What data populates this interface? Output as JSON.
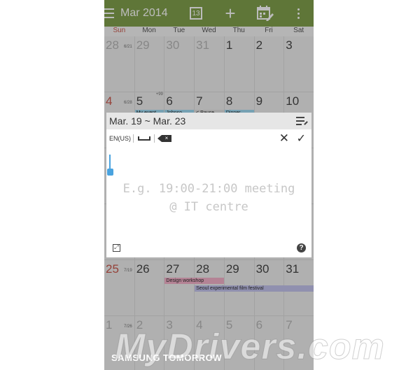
{
  "topbar": {
    "title": "Mar 2014",
    "today_date": "13",
    "add_symbol": "+",
    "bg": "#6a8f2a"
  },
  "weekdays": [
    "Sun",
    "Mon",
    "Tue",
    "Wed",
    "Thu",
    "Fri",
    "Sat"
  ],
  "weeks": [
    {
      "days": [
        {
          "n": "28",
          "faded": true
        },
        {
          "n": "29",
          "faded": true
        },
        {
          "n": "30",
          "faded": true
        },
        {
          "n": "31",
          "faded": true
        },
        {
          "n": "1"
        },
        {
          "n": "2"
        },
        {
          "n": "3"
        }
      ],
      "week_label": "6/21"
    },
    {
      "days": [
        {
          "n": "4",
          "red": true
        },
        {
          "n": "5",
          "more": "+99"
        },
        {
          "n": "6"
        },
        {
          "n": "7"
        },
        {
          "n": "8"
        },
        {
          "n": "9"
        },
        {
          "n": "10"
        }
      ],
      "week_label": "6/28",
      "events": [
        {
          "text": "My event",
          "col": 1,
          "span": 1,
          "color": "#8fd3f1"
        },
        {
          "text": "Johnso",
          "col": 2,
          "span": 1,
          "color": "#8fd3f1"
        },
        {
          "text": "< Pause",
          "col": 3,
          "span": 1,
          "color": "#dcdcdc"
        },
        {
          "text": "Dinner",
          "col": 4,
          "span": 1,
          "color": "#8fd3f1"
        }
      ]
    },
    {
      "days": []
    },
    {
      "days": []
    },
    {
      "days": [
        {
          "n": "25",
          "red": true
        },
        {
          "n": "26"
        },
        {
          "n": "27"
        },
        {
          "n": "28"
        },
        {
          "n": "29"
        },
        {
          "n": "30"
        },
        {
          "n": "31"
        }
      ],
      "week_label": "7/19",
      "events": [
        {
          "text": "Design workshop",
          "col": 2,
          "span": 2,
          "color": "#f2a3c0",
          "row": 0
        },
        {
          "text": "Seoul experimental film festival",
          "col": 3,
          "span": 4,
          "color": "#b9b8ea",
          "row": 1
        }
      ]
    },
    {
      "days": [
        {
          "n": "1",
          "faded": true
        },
        {
          "n": "2",
          "faded": true
        },
        {
          "n": "3",
          "faded": true
        },
        {
          "n": "4",
          "faded": true
        },
        {
          "n": "5",
          "faded": true
        },
        {
          "n": "6",
          "faded": true
        },
        {
          "n": "7",
          "faded": true
        }
      ],
      "week_label": "7/26"
    }
  ],
  "dialog": {
    "range": "Mar. 19 ~ Mar. 23",
    "lang": "EN(US)",
    "backspace_symbol": "×",
    "close_symbol": "✕",
    "confirm_symbol": "✓",
    "hint_line1": "E.g. 19:00-21:00 meeting",
    "hint_line2": "@ IT centre",
    "expand_symbol": "⤢",
    "help_symbol": "?"
  },
  "brand": "SAMSUNG TOMORROW",
  "watermark": "MyDrivers.com"
}
